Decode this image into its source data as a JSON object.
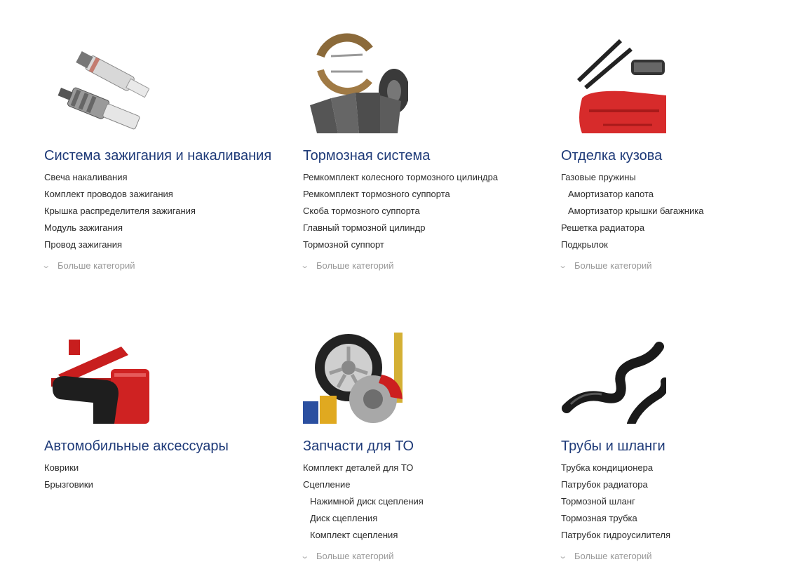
{
  "categories": [
    {
      "icon": "spark-plug-icon",
      "title": "Система зажигания и накаливания",
      "links": [
        {
          "label": "Свеча накаливания"
        },
        {
          "label": "Комплект проводов зажигания"
        },
        {
          "label": "Крышка распределителя зажигания"
        },
        {
          "label": "Модуль зажигания"
        },
        {
          "label": "Провод зажигания"
        }
      ],
      "more_label": "Больше категорий"
    },
    {
      "icon": "brake-parts-icon",
      "title": "Тормозная система",
      "links": [
        {
          "label": "Ремкомплект колесного тормозного цилиндра"
        },
        {
          "label": "Ремкомплект тормозного суппорта"
        },
        {
          "label": "Скоба тормозного суппорта"
        },
        {
          "label": "Главный тормозной цилиндр"
        },
        {
          "label": "Тормозной суппорт"
        }
      ],
      "more_label": "Больше категорий"
    },
    {
      "icon": "body-parts-icon",
      "title": "Отделка кузова",
      "links": [
        {
          "label": "Газовые пружины"
        },
        {
          "label": "Амортизатор капота"
        },
        {
          "label": "Амортизатор крышки багажника"
        },
        {
          "label": "Решетка радиатора"
        },
        {
          "label": "Подкрылок"
        }
      ],
      "more_label": "Больше категорий"
    },
    {
      "icon": "car-jack-icon",
      "title": "Автомобильные аксессуары",
      "links": [
        {
          "label": "Коврики"
        },
        {
          "label": "Брызговики"
        }
      ]
    },
    {
      "icon": "service-parts-icon",
      "title": "Запчасти для ТО",
      "links": [
        {
          "label": "Комплект деталей для ТО"
        },
        {
          "label": "Сцепление"
        },
        {
          "label": "Нажимной диск сцепления"
        },
        {
          "label": "Диск сцепления"
        },
        {
          "label": "Комплект сцепления"
        }
      ],
      "more_label": "Больше категорий"
    },
    {
      "icon": "hose-icon",
      "title": "Трубы и шланги",
      "links": [
        {
          "label": "Трубка кондиционера"
        },
        {
          "label": "Патрубок радиатора"
        },
        {
          "label": "Тормозной шланг"
        },
        {
          "label": "Тормозная трубка"
        },
        {
          "label": "Патрубок гидроусилителя"
        }
      ],
      "more_label": "Больше категорий"
    }
  ],
  "colors": {
    "title": "#1e3a78",
    "link": "#2b2b2b",
    "more": "#999999"
  }
}
